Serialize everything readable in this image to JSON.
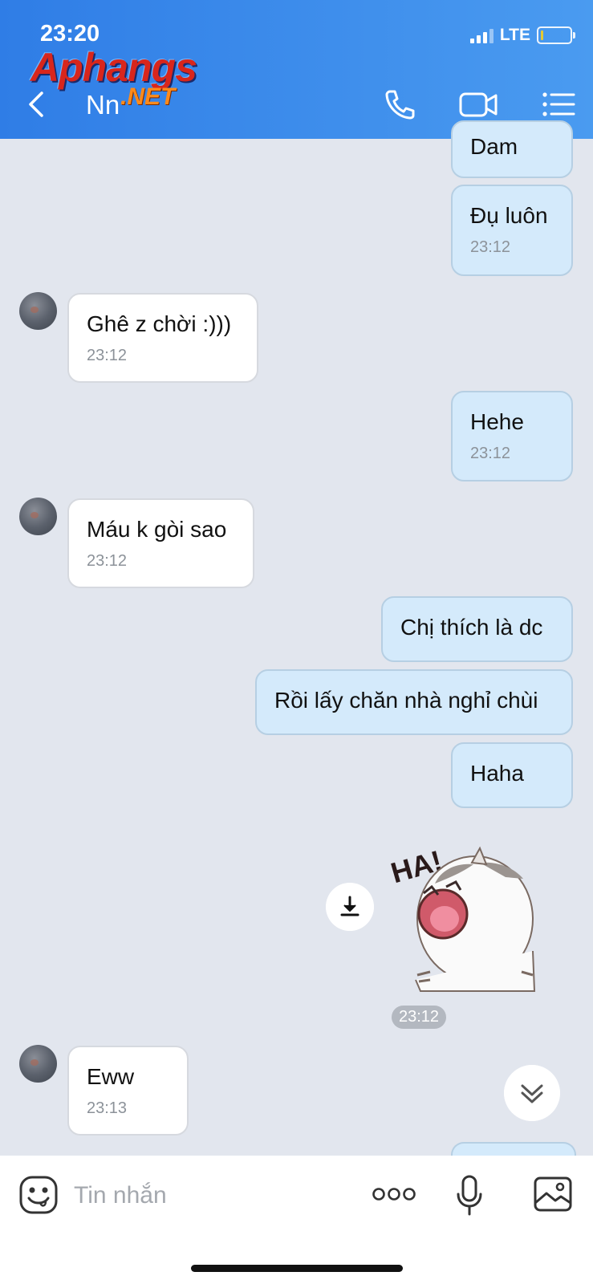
{
  "status_bar": {
    "time": "23:20",
    "network": "LTE"
  },
  "watermark": {
    "main": "Aphangs",
    "sub": ".NET"
  },
  "header": {
    "title": "Nn"
  },
  "messages": [
    {
      "dir": "out",
      "text": "Dam",
      "time": ""
    },
    {
      "dir": "out",
      "text": "Đụ luôn",
      "time": "23:12"
    },
    {
      "dir": "in",
      "text": "Ghê z chời :)))",
      "time": "23:12"
    },
    {
      "dir": "out",
      "text": "Hehe",
      "time": "23:12"
    },
    {
      "dir": "in",
      "text": "Máu k gòi sao",
      "time": "23:12"
    },
    {
      "dir": "out",
      "text": "Chị thích là dc",
      "time": ""
    },
    {
      "dir": "out",
      "text": "Rồi lấy chăn nhà nghỉ chùi",
      "time": ""
    },
    {
      "dir": "out",
      "text": "Haha",
      "time": ""
    },
    {
      "dir": "in",
      "text": "Eww",
      "time": "23:13"
    }
  ],
  "sticker": {
    "text": "HA!",
    "time": "23:12"
  },
  "input": {
    "placeholder": "Tin nhắn"
  },
  "colors": {
    "header_start": "#2f7de6",
    "header_end": "#4a9bf0",
    "bubble_out": "#d4eafb",
    "bubble_in": "#ffffff",
    "chat_bg": "#e2e6ee"
  },
  "icons": [
    "back-icon",
    "phone-icon",
    "video-icon",
    "menu-list-icon",
    "download-icon",
    "chevron-double-down-icon",
    "emoji-icon",
    "more-icon",
    "mic-icon",
    "image-icon"
  ]
}
